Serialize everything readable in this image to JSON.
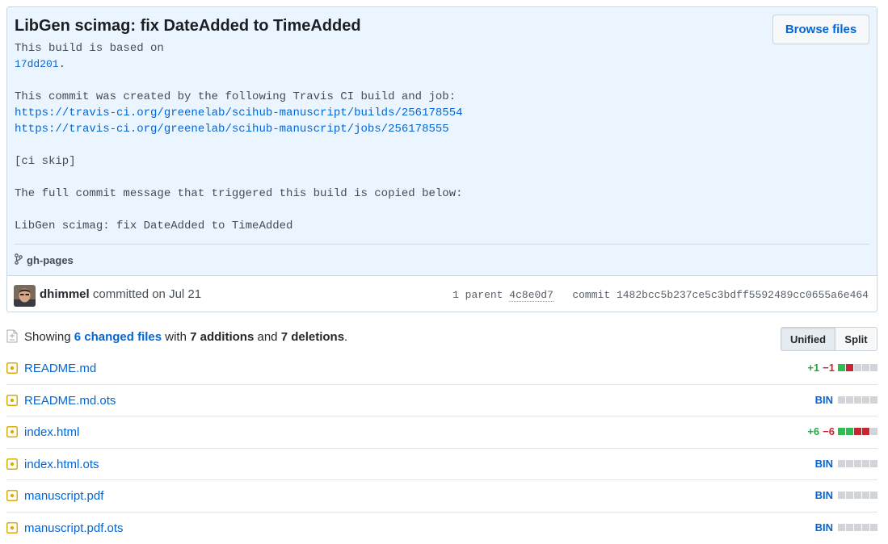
{
  "commit": {
    "title": "LibGen scimag: fix DateAdded to TimeAdded",
    "browse_label": "Browse files",
    "desc": {
      "l1": "This build is based on",
      "l2_sha": "17dd201",
      "l2_rest": ".",
      "l3": "",
      "l4": "This commit was created by the following Travis CI build and job:",
      "build_url": "https://travis-ci.org/greenelab/scihub-manuscript/builds/256178554",
      "job_url": "https://travis-ci.org/greenelab/scihub-manuscript/jobs/256178555",
      "l7": "",
      "l8": "[ci skip]",
      "l9": "",
      "l10": "The full commit message that triggered this build is copied below:",
      "l11": "",
      "l12": "LibGen scimag: fix DateAdded to TimeAdded"
    },
    "branch": "gh-pages",
    "author": "dhimmel",
    "committed_text": "committed on Jul 21",
    "parent_label": "1 parent",
    "parent_sha": "4c8e0d7",
    "commit_label": "commit",
    "commit_sha": "1482bcc5b237ce5c3bdff5592489cc0655a6e464"
  },
  "summary": {
    "showing": "Showing",
    "changed_files": "6 changed files",
    "with": "with",
    "additions": "7 additions",
    "and": "and",
    "deletions": "7 deletions",
    "period": "."
  },
  "view_toggle": {
    "unified": "Unified",
    "split": "Split",
    "selected": "Unified"
  },
  "files": [
    {
      "name": "README.md",
      "add": "+1",
      "del": "−1",
      "blocks": [
        "g",
        "r",
        "n",
        "n",
        "n"
      ]
    },
    {
      "name": "README.md.ots",
      "bin": "BIN",
      "blocks": [
        "n",
        "n",
        "n",
        "n",
        "n"
      ]
    },
    {
      "name": "index.html",
      "add": "+6",
      "del": "−6",
      "blocks": [
        "g",
        "g",
        "r",
        "r",
        "n"
      ]
    },
    {
      "name": "index.html.ots",
      "bin": "BIN",
      "blocks": [
        "n",
        "n",
        "n",
        "n",
        "n"
      ]
    },
    {
      "name": "manuscript.pdf",
      "bin": "BIN",
      "blocks": [
        "n",
        "n",
        "n",
        "n",
        "n"
      ]
    },
    {
      "name": "manuscript.pdf.ots",
      "bin": "BIN",
      "blocks": [
        "n",
        "n",
        "n",
        "n",
        "n"
      ]
    }
  ],
  "colors": {
    "link": "#0366d6",
    "addition": "#2cbe4e",
    "deletion": "#cb2431",
    "header_bg": "#eaf5ff",
    "modified_icon": "#dbab09"
  },
  "icons": {
    "branch": "git-branch-icon",
    "file_summary": "file-diff-icon",
    "modified": "file-modified-icon"
  }
}
